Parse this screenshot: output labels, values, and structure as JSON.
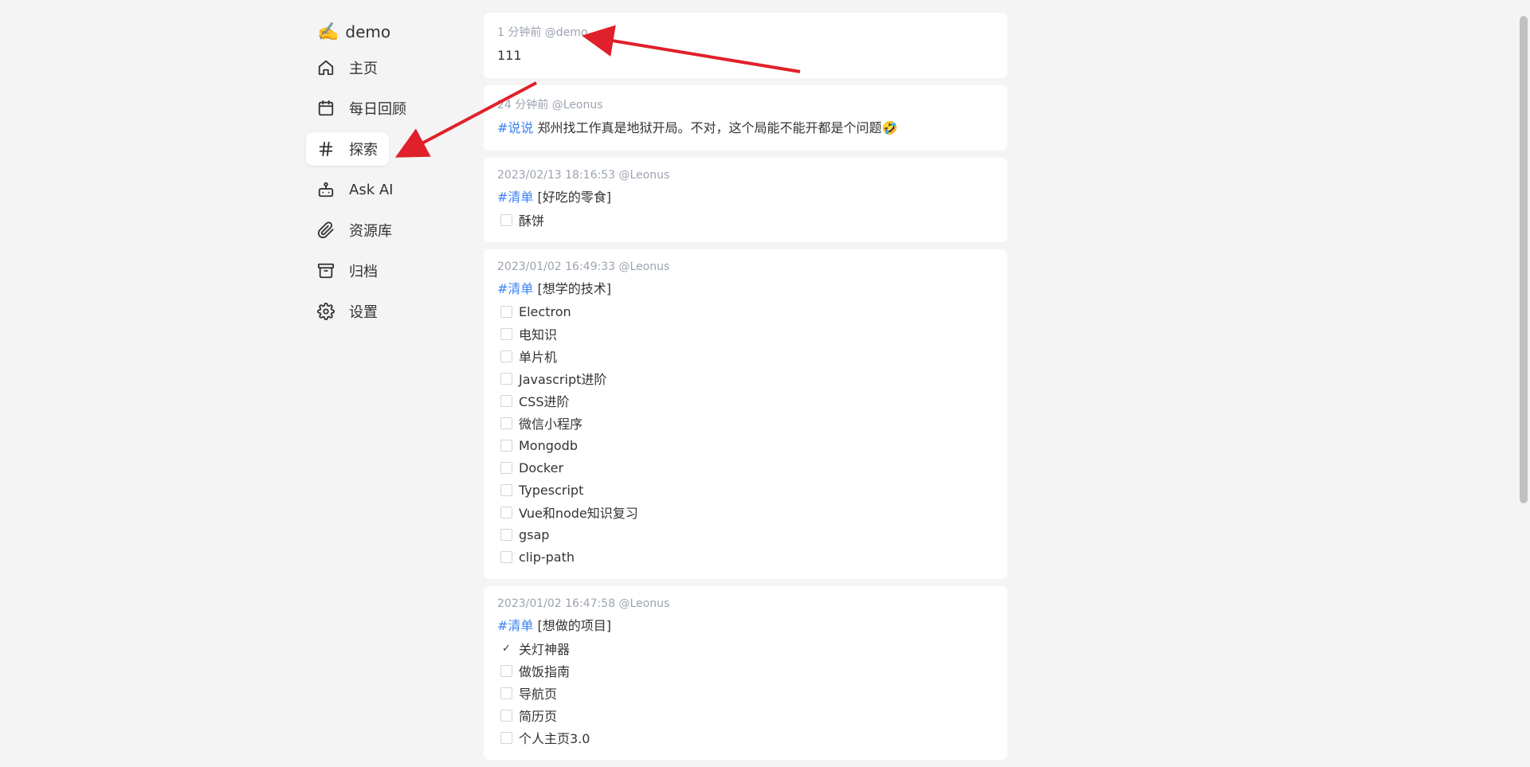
{
  "brand": {
    "emoji": "✍️",
    "name": "demo"
  },
  "nav": [
    {
      "icon": "home-icon",
      "label": "主页"
    },
    {
      "icon": "calendar-icon",
      "label": "每日回顾"
    },
    {
      "icon": "hash-icon",
      "label": "探索"
    },
    {
      "icon": "bot-icon",
      "label": "Ask AI"
    },
    {
      "icon": "paperclip-icon",
      "label": "资源库"
    },
    {
      "icon": "archive-icon",
      "label": "归档"
    },
    {
      "icon": "gear-icon",
      "label": "设置"
    }
  ],
  "memos": [
    {
      "meta": "1 分钟前 @demo",
      "text": "111"
    },
    {
      "meta": "24 分钟前 @Leonus",
      "tag": "#说说",
      "text": " 郑州找工作真是地狱开局。不对，这个局能不能开都是个问题🤣"
    },
    {
      "meta": "2023/02/13 18:16:53 @Leonus",
      "tag": "#清单",
      "text": " [好吃的零食]",
      "tasks": [
        {
          "label": "酥饼",
          "done": false
        }
      ]
    },
    {
      "meta": "2023/01/02 16:49:33 @Leonus",
      "tag": "#清单",
      "text": " [想学的技术]",
      "tasks": [
        {
          "label": "Electron",
          "done": false
        },
        {
          "label": "电知识",
          "done": false
        },
        {
          "label": "单片机",
          "done": false
        },
        {
          "label": "Javascript进阶",
          "done": false
        },
        {
          "label": "CSS进阶",
          "done": false
        },
        {
          "label": "微信小程序",
          "done": false
        },
        {
          "label": "Mongodb",
          "done": false
        },
        {
          "label": "Docker",
          "done": false
        },
        {
          "label": "Typescript",
          "done": false
        },
        {
          "label": "Vue和node知识复习",
          "done": false
        },
        {
          "label": "gsap",
          "done": false
        },
        {
          "label": "clip-path",
          "done": false
        }
      ]
    },
    {
      "meta": "2023/01/02 16:47:58 @Leonus",
      "tag": "#清单",
      "text": " [想做的项目]",
      "tasks": [
        {
          "label": "关灯神器",
          "done": true
        },
        {
          "label": "做饭指南",
          "done": false
        },
        {
          "label": "导航页",
          "done": false
        },
        {
          "label": "简历页",
          "done": false
        },
        {
          "label": "个人主页3.0",
          "done": false
        }
      ]
    }
  ],
  "colors": {
    "tag": "#3b82f6",
    "arrow": "#e0202a",
    "active_bg": "#ffffff"
  }
}
